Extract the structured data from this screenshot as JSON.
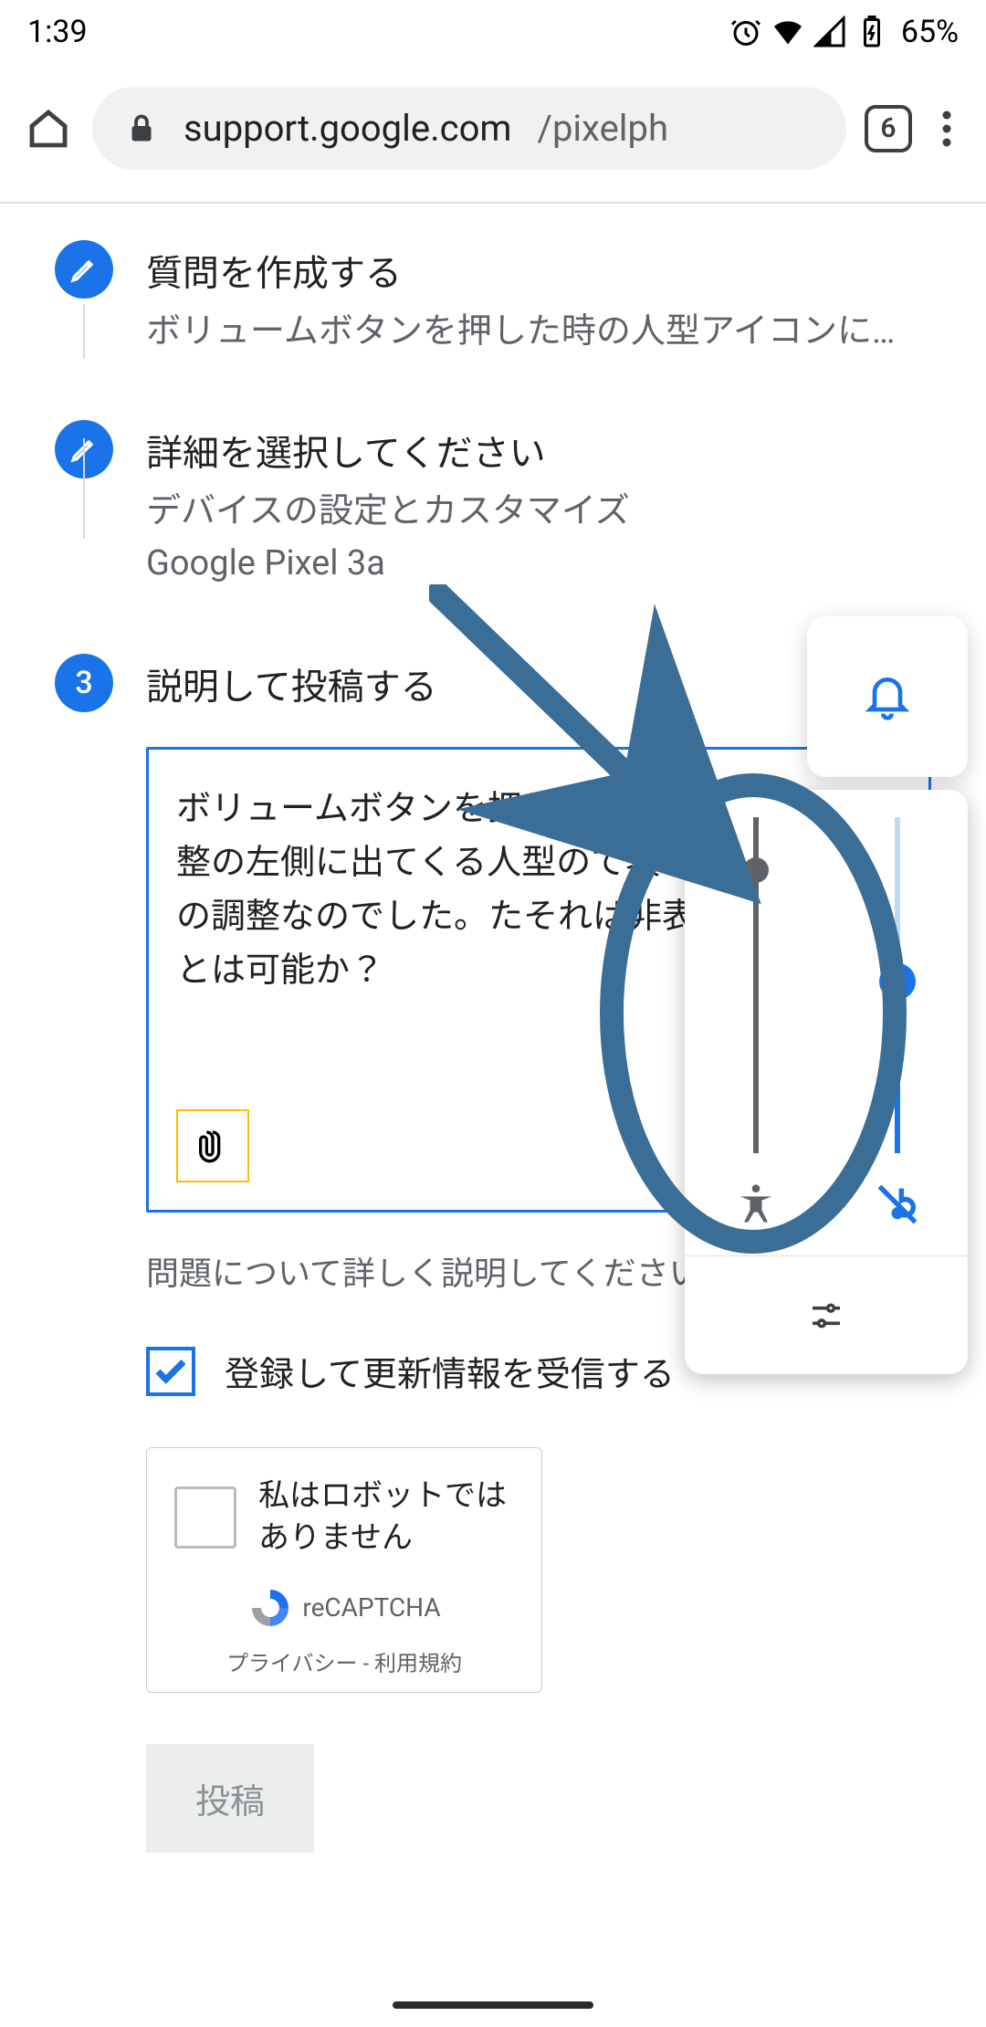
{
  "status": {
    "time": "1:39",
    "battery_percent": "65%"
  },
  "browser": {
    "url_host": "support.google.com",
    "url_path": "/pixelph",
    "tab_count": "6"
  },
  "steps": {
    "s1": {
      "title": "質問を作成する",
      "sub": "ボリュームボタンを押した時の人型アイコンに…"
    },
    "s2": {
      "title": "詳細を選択してください",
      "sub1": "デバイスの設定とカスタマイズ",
      "sub2": "Google Pixel 3a"
    },
    "s3": {
      "number": "3",
      "title": "説明して投稿する"
    }
  },
  "editor": {
    "text": "ボリュームボタンを押した際、メディア量調整の左側に出てくる人型のて表される物は何の調整なのでした。たそれは非表示にすることは可能か？"
  },
  "helper": {
    "text": "問題について詳しく説明してください。"
  },
  "checkbox": {
    "label": "登録して更新情報を受信する"
  },
  "recaptcha": {
    "label": "私はロボットではありません",
    "brand": "reCAPTCHA",
    "links": "プライバシー - 利用規約"
  },
  "submit": {
    "label": "投稿"
  }
}
